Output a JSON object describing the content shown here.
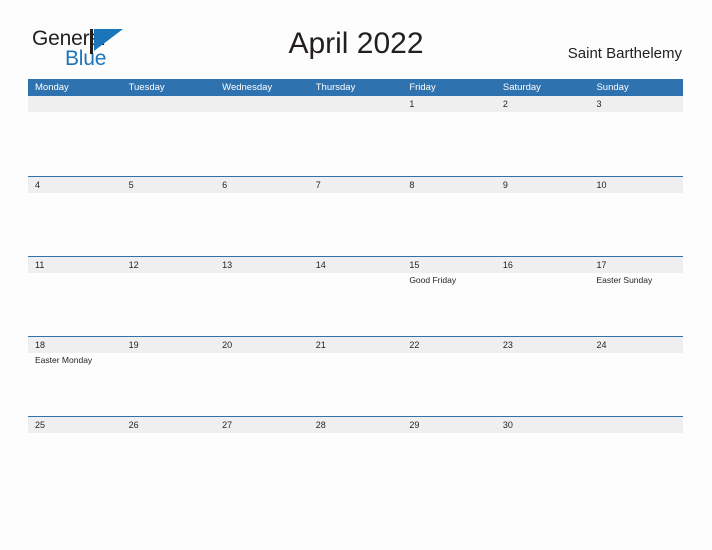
{
  "brand": {
    "name_part1": "General",
    "name_part2": "Blue",
    "mark": "triangle-flag-icon",
    "accent_color": "#1b75bb"
  },
  "header": {
    "month_title": "April 2022",
    "region": "Saint Barthelemy"
  },
  "colors": {
    "header_blue": "#2e72b0",
    "strip_gray": "#efefef",
    "body_white": "#fdfdfd",
    "text": "#231f20"
  },
  "calendar": {
    "weekdays": [
      "Monday",
      "Tuesday",
      "Wednesday",
      "Thursday",
      "Friday",
      "Saturday",
      "Sunday"
    ],
    "weeks": [
      {
        "days": [
          {
            "date": "",
            "events": []
          },
          {
            "date": "",
            "events": []
          },
          {
            "date": "",
            "events": []
          },
          {
            "date": "",
            "events": []
          },
          {
            "date": "1",
            "events": []
          },
          {
            "date": "2",
            "events": []
          },
          {
            "date": "3",
            "events": []
          }
        ]
      },
      {
        "days": [
          {
            "date": "4",
            "events": []
          },
          {
            "date": "5",
            "events": []
          },
          {
            "date": "6",
            "events": []
          },
          {
            "date": "7",
            "events": []
          },
          {
            "date": "8",
            "events": []
          },
          {
            "date": "9",
            "events": []
          },
          {
            "date": "10",
            "events": []
          }
        ]
      },
      {
        "days": [
          {
            "date": "11",
            "events": []
          },
          {
            "date": "12",
            "events": []
          },
          {
            "date": "13",
            "events": []
          },
          {
            "date": "14",
            "events": []
          },
          {
            "date": "15",
            "events": [
              "Good Friday"
            ]
          },
          {
            "date": "16",
            "events": []
          },
          {
            "date": "17",
            "events": [
              "Easter Sunday"
            ]
          }
        ]
      },
      {
        "days": [
          {
            "date": "18",
            "events": [
              "Easter Monday"
            ]
          },
          {
            "date": "19",
            "events": []
          },
          {
            "date": "20",
            "events": []
          },
          {
            "date": "21",
            "events": []
          },
          {
            "date": "22",
            "events": []
          },
          {
            "date": "23",
            "events": []
          },
          {
            "date": "24",
            "events": []
          }
        ]
      },
      {
        "days": [
          {
            "date": "25",
            "events": []
          },
          {
            "date": "26",
            "events": []
          },
          {
            "date": "27",
            "events": []
          },
          {
            "date": "28",
            "events": []
          },
          {
            "date": "29",
            "events": []
          },
          {
            "date": "30",
            "events": []
          },
          {
            "date": "",
            "events": []
          }
        ]
      }
    ]
  }
}
